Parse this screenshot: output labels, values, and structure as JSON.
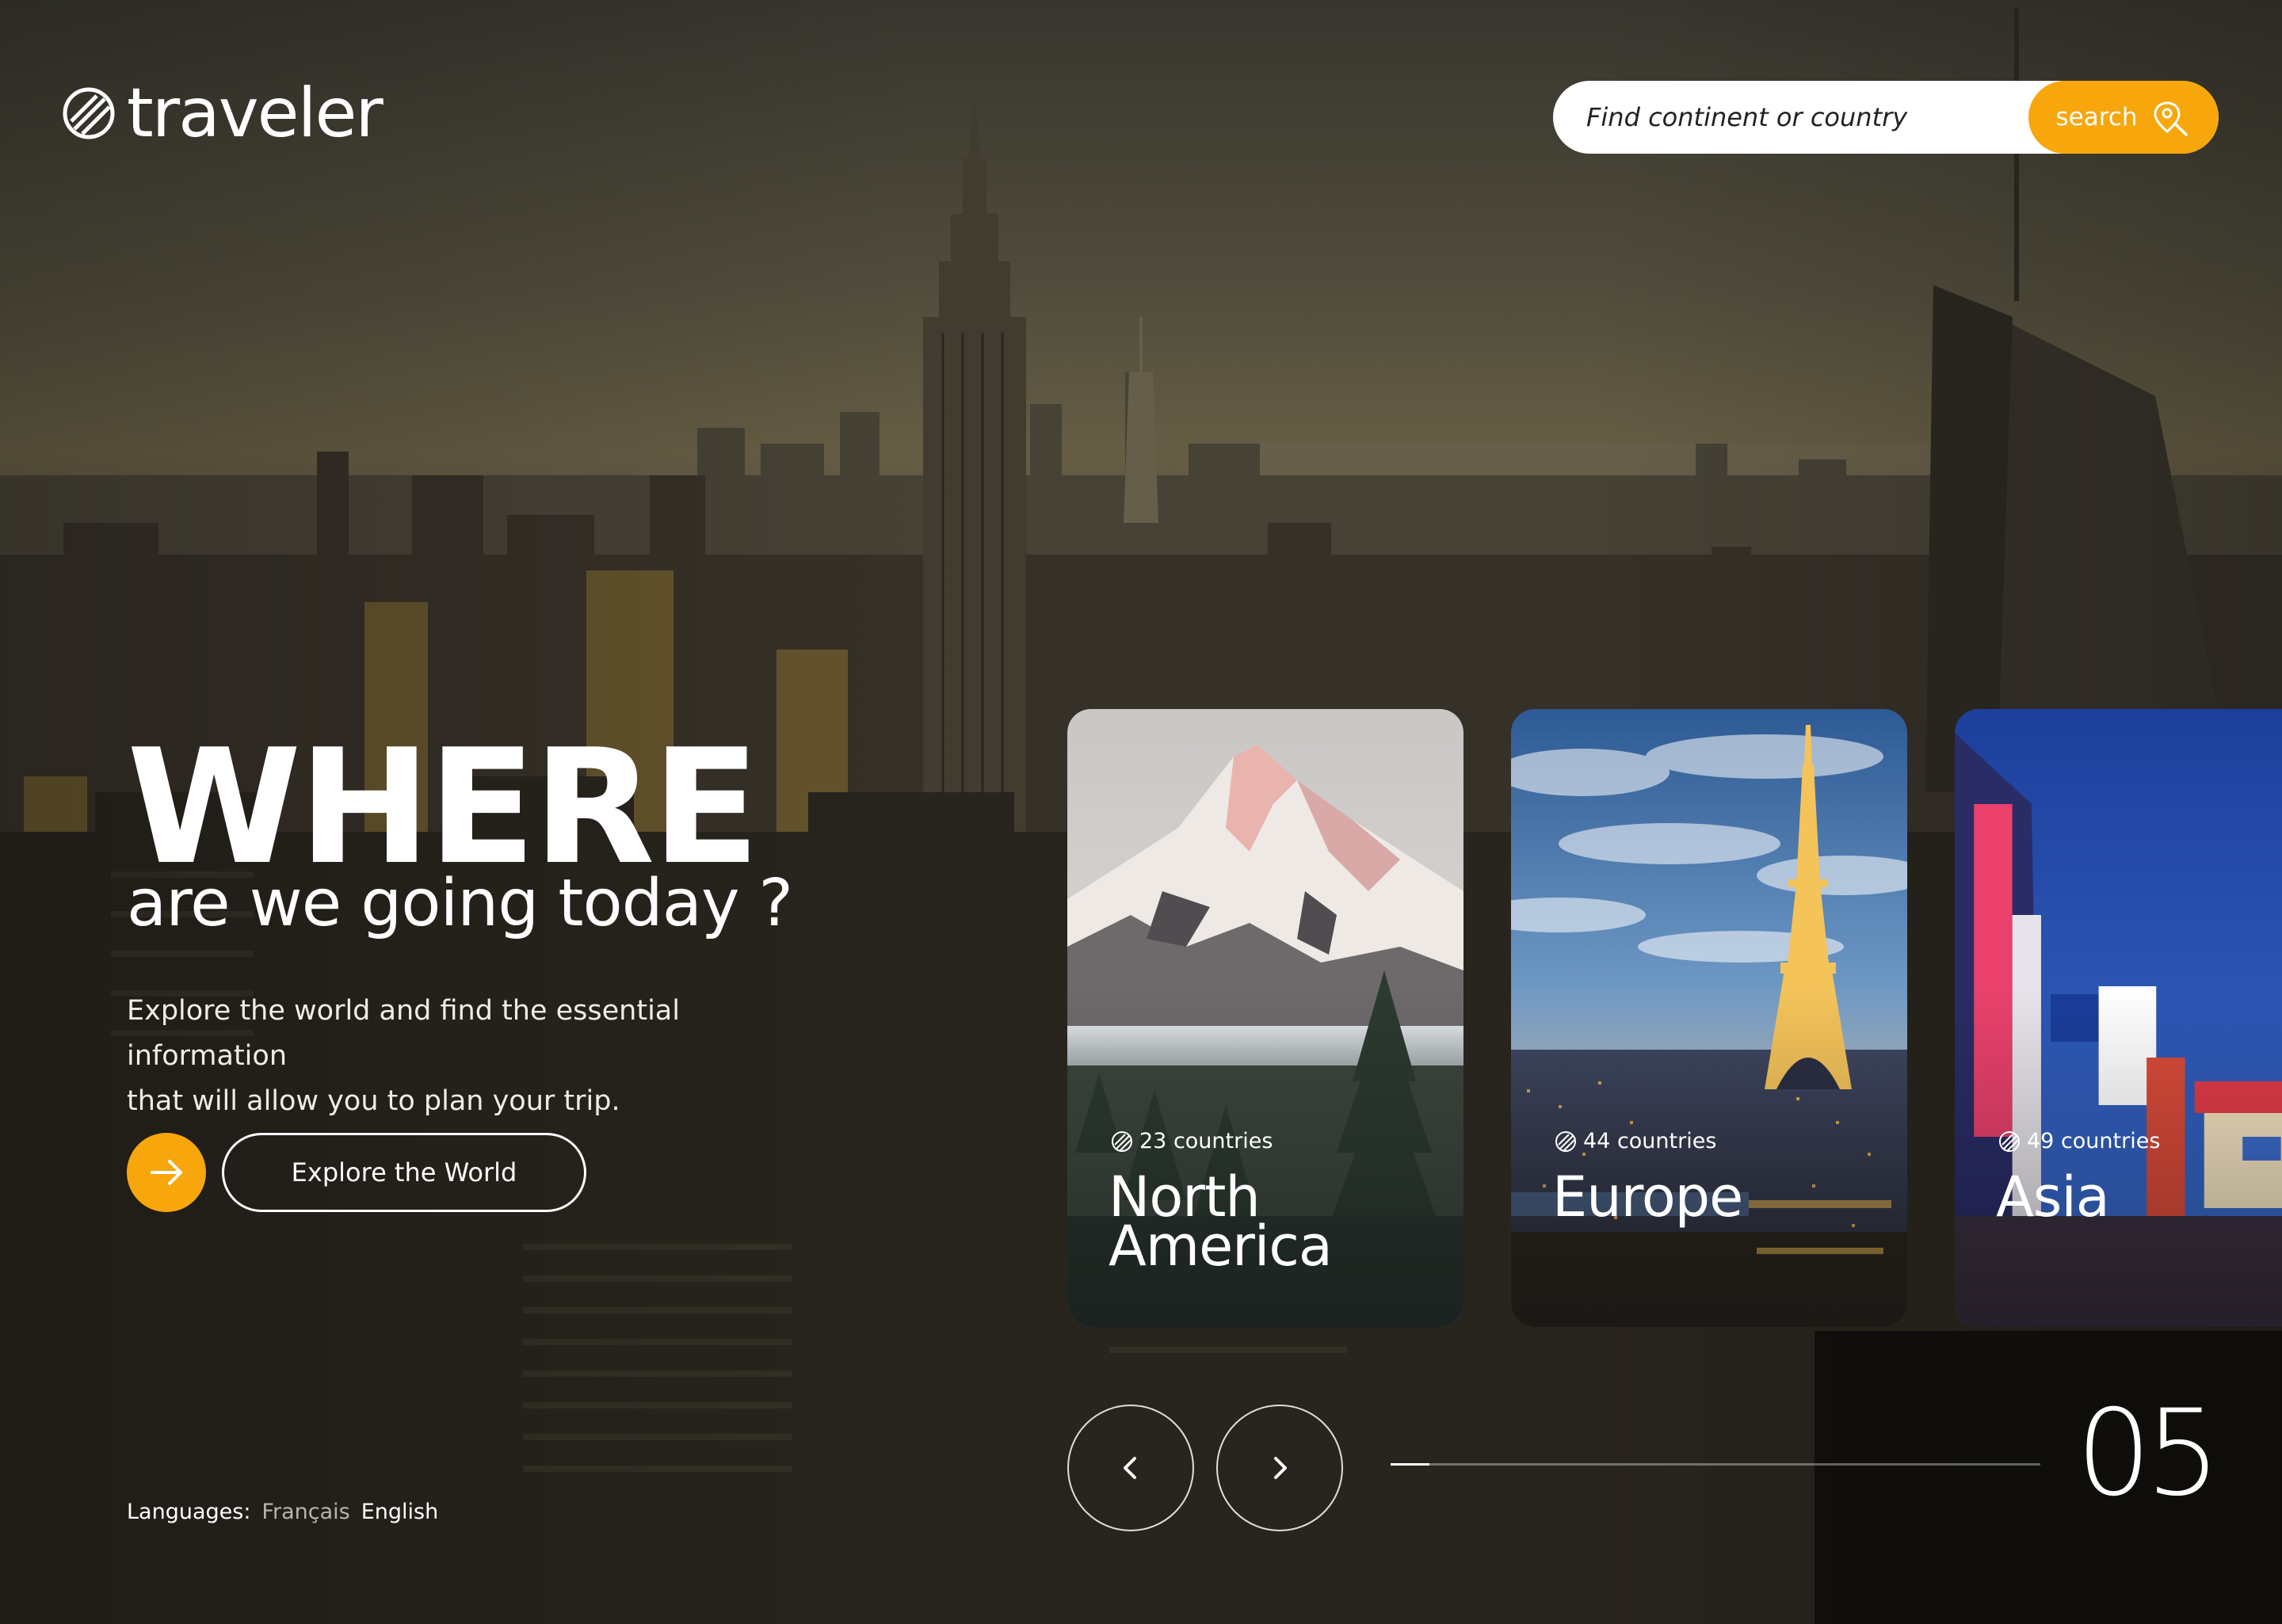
{
  "brand": {
    "name": "traveler",
    "icon": "globe-icon"
  },
  "search": {
    "placeholder": "Find continent or country",
    "button_label": "search",
    "button_icon": "map-pin-search-icon"
  },
  "hero": {
    "title": "WHERE",
    "subtitle": "are we going today ?",
    "description_line1": "Explore the world and find the essential information",
    "description_line2": "that will allow you to plan your trip.",
    "cta_icon": "arrow-right-icon",
    "cta_label": "Explore the World"
  },
  "languages": {
    "label": "Languages:",
    "options": [
      "Français",
      "English"
    ],
    "active": "English"
  },
  "cards": [
    {
      "count": "23 countries",
      "name_line1": "North",
      "name_line2": "America"
    },
    {
      "count": "44 countries",
      "name_line1": "Europe",
      "name_line2": ""
    },
    {
      "count": "49 countries",
      "name_line1": "Asia",
      "name_line2": ""
    }
  ],
  "slider": {
    "prev_icon": "chevron-left-icon",
    "next_icon": "chevron-right-icon",
    "progress_fraction": 0.06,
    "current": "05"
  },
  "colors": {
    "accent": "#f7a70c",
    "text": "#ffffff",
    "search_bg": "#ffffff"
  }
}
